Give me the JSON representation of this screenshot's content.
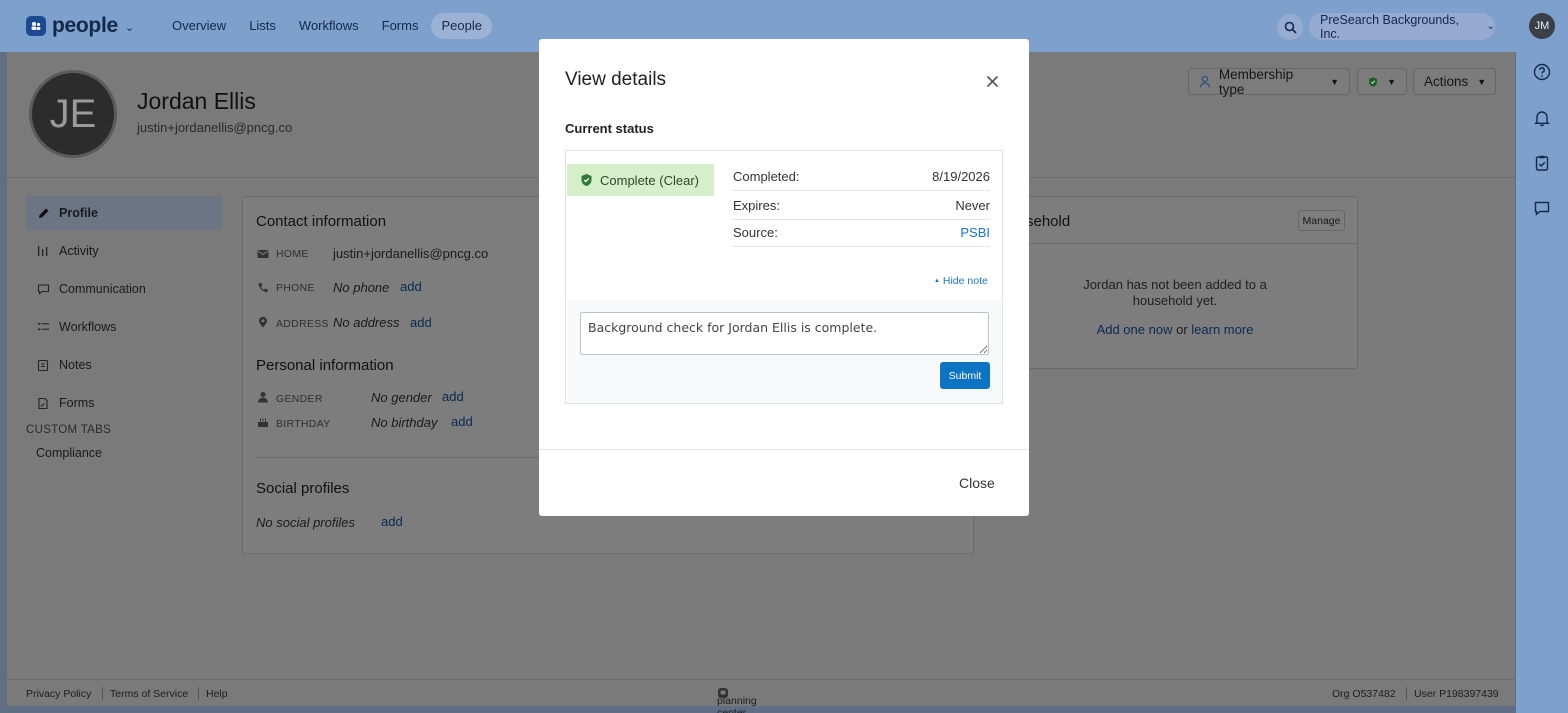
{
  "app": {
    "name": "people",
    "colors": {
      "brand": "#1b4a92",
      "topbar": "#7ea0cd",
      "link": "#1a76c5",
      "success_bg": "#d5efcb",
      "submit": "#0d73c3"
    }
  },
  "topbar": {
    "nav": [
      "Overview",
      "Lists",
      "Workflows",
      "Forms",
      "People"
    ],
    "active_nav": "People",
    "org": "PreSearch Backgrounds, Inc.",
    "user_initials": "JM"
  },
  "rail": {
    "icons": [
      "help-icon",
      "bell-icon",
      "clipboard-check-icon",
      "chat-icon"
    ]
  },
  "person": {
    "initials": "JE",
    "name": "Jordan Ellis",
    "email": "justin+jordanellis@pncg.co"
  },
  "header_buttons": {
    "membership": "Membership type",
    "actions": "Actions"
  },
  "sidebar": {
    "items": [
      {
        "label": "Profile",
        "icon": "pencil-icon"
      },
      {
        "label": "Activity",
        "icon": "bars-icon"
      },
      {
        "label": "Communication",
        "icon": "chat-icon"
      },
      {
        "label": "Workflows",
        "icon": "workflow-icon"
      },
      {
        "label": "Notes",
        "icon": "note-icon"
      },
      {
        "label": "Forms",
        "icon": "form-icon"
      }
    ],
    "custom_heading": "CUSTOM TABS",
    "custom_items": [
      "Compliance"
    ]
  },
  "contact": {
    "title": "Contact information",
    "home_label": "HOME",
    "home_value": "justin+jordanellis@pncg.co",
    "phone_label": "PHONE",
    "phone_value": "No phone",
    "address_label": "ADDRESS",
    "address_value": "No address",
    "add": "add"
  },
  "personal": {
    "title": "Personal information",
    "gender_label": "GENDER",
    "gender_value": "No gender",
    "birthday_label": "BIRTHDAY",
    "birthday_value": "No birthday"
  },
  "social": {
    "title": "Social profiles",
    "value": "No social profiles"
  },
  "household": {
    "title_visible": "sehold",
    "manage": "Manage",
    "empty_line1": "Jordan has not been added to a",
    "empty_line2": "household yet.",
    "add_link": "Add one now",
    "or": "or",
    "learn_link": "learn more"
  },
  "footer": {
    "privacy": "Privacy Policy",
    "terms": "Terms of Service",
    "help": "Help",
    "brand": "planning center",
    "org_id": "Org O537482",
    "user_id": "User P198397439"
  },
  "modal": {
    "title": "View details",
    "status_heading": "Current status",
    "badge": "Complete (Clear)",
    "completed_label": "Completed:",
    "completed_value": "8/19/2026",
    "expires_label": "Expires:",
    "expires_value": "Never",
    "source_label": "Source:",
    "source_value": "PSBI",
    "hide_note": "Hide note",
    "note_text": "Background check for Jordan Ellis is complete.",
    "submit": "Submit",
    "close": "Close"
  }
}
